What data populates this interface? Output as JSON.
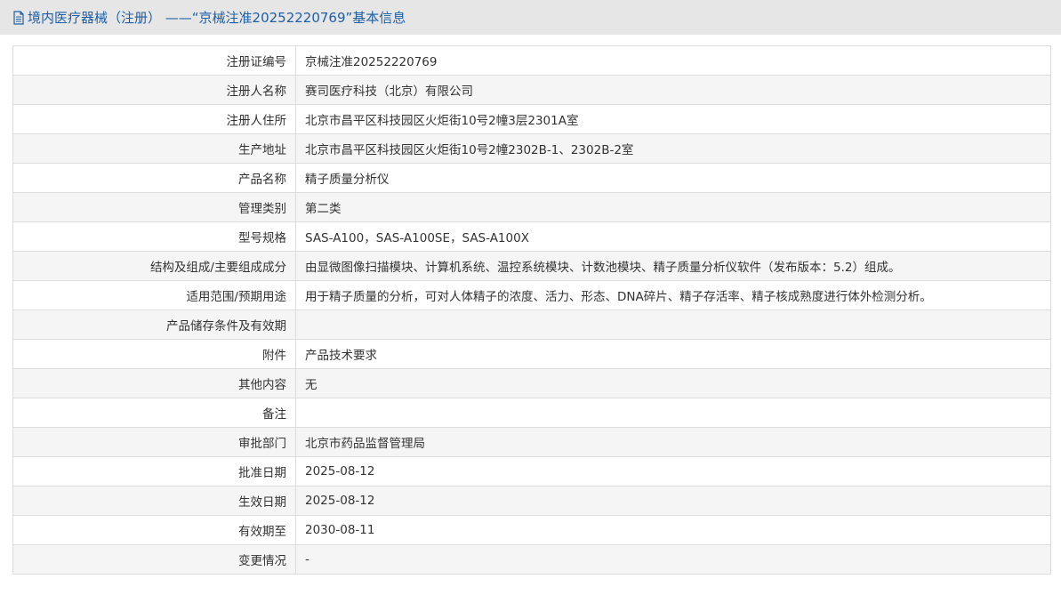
{
  "header": {
    "icon": "document-icon",
    "title": "境内医疗器械（注册） ——“京械注准20252220769”基本信息",
    "title_color": "#1d5fa6",
    "background": "#e6e6e6"
  },
  "table": {
    "rows": [
      {
        "label": "注册证编号",
        "value": "京械注准20252220769"
      },
      {
        "label": "注册人名称",
        "value": "赛司医疗科技（北京）有限公司"
      },
      {
        "label": "注册人住所",
        "value": "北京市昌平区科技园区火炬街10号2幢3层2301A室"
      },
      {
        "label": "生产地址",
        "value": "北京市昌平区科技园区火炬街10号2幢2302B-1、2302B-2室"
      },
      {
        "label": "产品名称",
        "value": "精子质量分析仪"
      },
      {
        "label": "管理类别",
        "value": "第二类"
      },
      {
        "label": "型号规格",
        "value": "SAS-A100，SAS-A100SE，SAS-A100X"
      },
      {
        "label": "结构及组成/主要组成成分",
        "value": "由显微图像扫描模块、计算机系统、温控系统模块、计数池模块、精子质量分析仪软件（发布版本：5.2）组成。"
      },
      {
        "label": "适用范围/预期用途",
        "value": "用于精子质量的分析，可对人体精子的浓度、活力、形态、DNA碎片、精子存活率、精子核成熟度进行体外检测分析。"
      },
      {
        "label": "产品储存条件及有效期",
        "value": ""
      },
      {
        "label": "附件",
        "value": "产品技术要求"
      },
      {
        "label": "其他内容",
        "value": "无"
      },
      {
        "label": "备注",
        "value": ""
      },
      {
        "label": "审批部门",
        "value": "北京市药品监督管理局"
      },
      {
        "label": "批准日期",
        "value": "2025-08-12"
      },
      {
        "label": "生效日期",
        "value": "2025-08-12"
      },
      {
        "label": "有效期至",
        "value": "2030-08-11"
      },
      {
        "label": "变更情况",
        "value": "-"
      }
    ]
  }
}
